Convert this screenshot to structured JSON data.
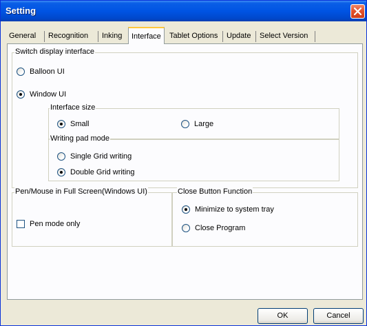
{
  "window": {
    "title": "Setting"
  },
  "tabs": [
    {
      "label": "General",
      "active": false
    },
    {
      "label": "Recognition",
      "active": false
    },
    {
      "label": "Inking",
      "active": false
    },
    {
      "label": "Interface",
      "active": true
    },
    {
      "label": "Tablet Options",
      "active": false
    },
    {
      "label": "Update",
      "active": false
    },
    {
      "label": "Select Version",
      "active": false
    }
  ],
  "switch_display": {
    "legend": "Switch display interface",
    "balloon_ui": {
      "label": "Balloon UI",
      "checked": false
    },
    "window_ui": {
      "label": "Window UI",
      "checked": true
    },
    "interface_size": {
      "legend": "Interface size",
      "small": {
        "label": "Small",
        "checked": true
      },
      "large": {
        "label": "Large",
        "checked": false
      }
    },
    "writing_pad_mode": {
      "legend": "Writing pad mode",
      "single_grid": {
        "label": "Single Grid writing",
        "checked": false
      },
      "double_grid": {
        "label": "Double Grid writing",
        "checked": true
      }
    }
  },
  "pen_mouse": {
    "legend": "Pen/Mouse in Full Screen(Windows UI)",
    "pen_mode_only": {
      "label": "Pen mode only",
      "checked": false
    }
  },
  "close_button_function": {
    "legend": "Close Button Function",
    "minimize": {
      "label": "Minimize to system tray",
      "checked": true
    },
    "close_program": {
      "label": "Close Program",
      "checked": false
    }
  },
  "buttons": {
    "ok": "OK",
    "cancel": "Cancel"
  },
  "icons": {
    "close": "close-icon"
  },
  "colors": {
    "titlebar": "#0054e3",
    "close_button": "#e4532d",
    "radio_selected": "#21a121",
    "active_tab_highlight": "#ffc83c"
  }
}
